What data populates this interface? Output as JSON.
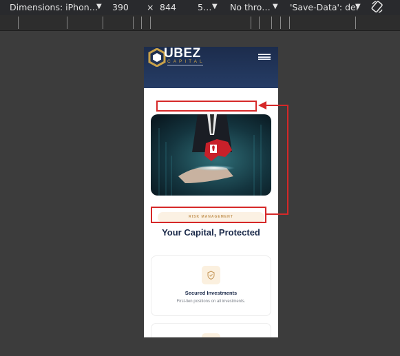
{
  "devtools": {
    "dimensions_label": "Dimensions: iPhon…",
    "width": "390",
    "times": "×",
    "height": "844",
    "zoom": "5…",
    "throttling": "No thro…",
    "save_data": "'Save-Data': def"
  },
  "site": {
    "logo_text": "UBEZ",
    "logo_sub": "CAPITAL",
    "badge": "RISK MANAGEMENT",
    "headline": "Your Capital, Protected",
    "cards": [
      {
        "title": "Secured Investments",
        "description": "First-lien positions on all investments."
      }
    ]
  },
  "colors": {
    "devtools_bar": "#292a2d",
    "header_navy": "#1c2c4c",
    "accent_gold": "#c9a24a",
    "annotation_red": "#d62828"
  }
}
